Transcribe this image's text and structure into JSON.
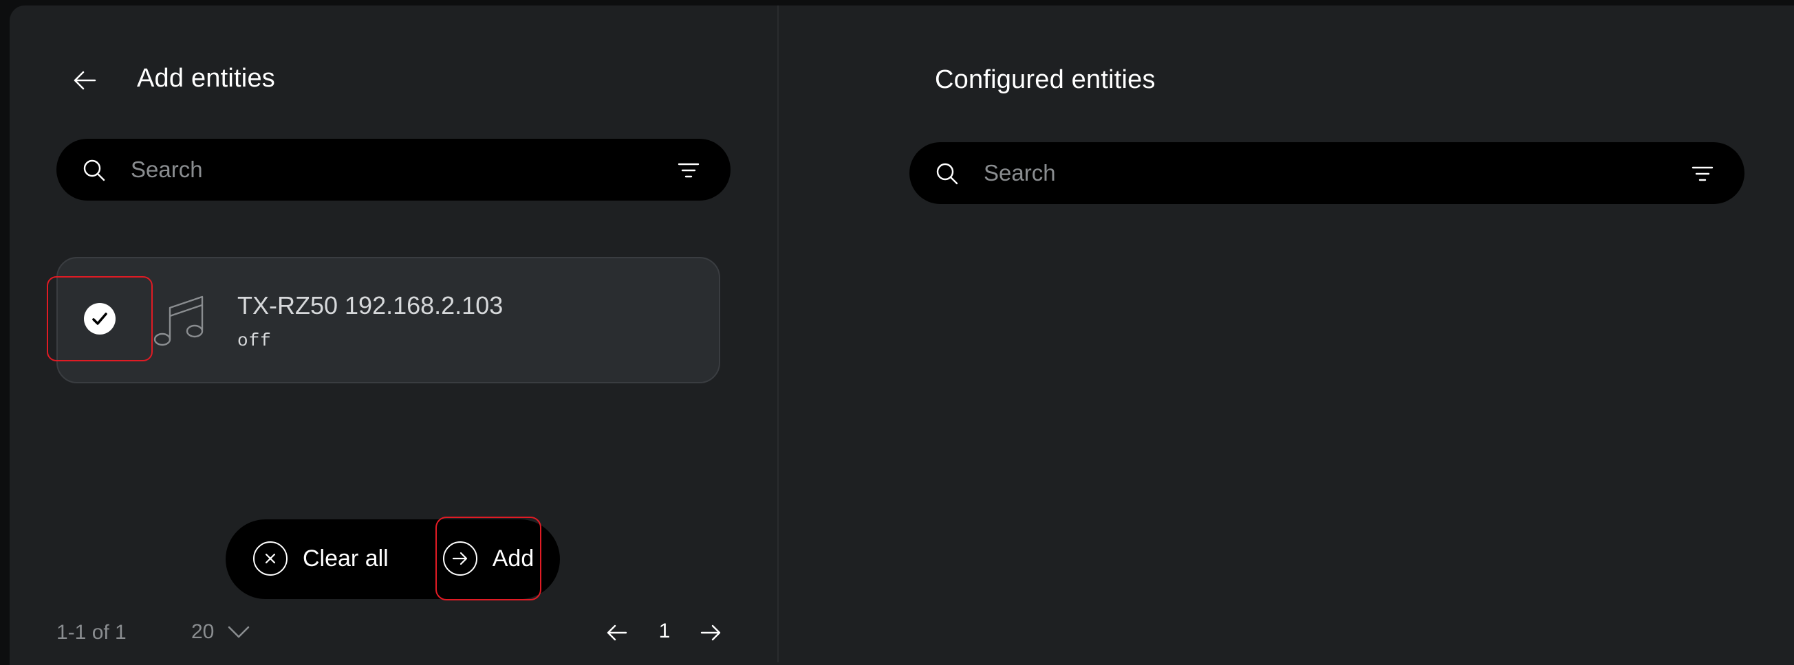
{
  "left_panel": {
    "title": "Add entities",
    "search": {
      "placeholder": "Search",
      "value": ""
    },
    "entities": [
      {
        "name": "TX-RZ50 192.168.2.103",
        "state": "off",
        "selected": true,
        "icon": "music-icon"
      }
    ],
    "actions": {
      "clear_label": "Clear all",
      "add_label": "Add"
    },
    "pagination": {
      "range": "1-1 of 1",
      "page_size": "20",
      "current_page": "1"
    }
  },
  "right_panel": {
    "title": "Configured entities",
    "search": {
      "placeholder": "Search",
      "value": ""
    }
  },
  "colors": {
    "background": "#1e2022",
    "card": "#2a2d30",
    "highlight": "#e01b24",
    "muted_text": "#8a8d90"
  }
}
